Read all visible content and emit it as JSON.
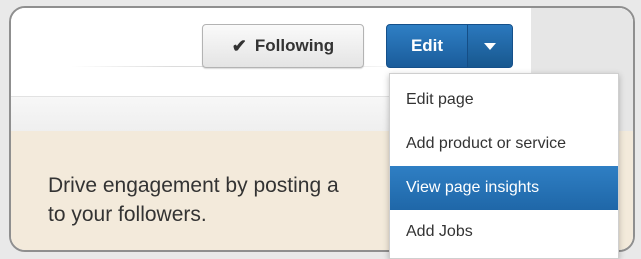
{
  "header": {
    "following_label": "Following",
    "following_icon": "checkmark-icon",
    "edit_label": "Edit",
    "edit_menu_icon": "caret-down-icon"
  },
  "dropdown": {
    "items": [
      {
        "label": "Edit page",
        "active": false
      },
      {
        "label": "Add product or service",
        "active": false
      },
      {
        "label": "View page insights",
        "active": true
      },
      {
        "label": "Add Jobs",
        "active": false
      }
    ]
  },
  "cta": {
    "line1": "Drive engagement by posting a",
    "line2": "to your followers."
  },
  "colors": {
    "accent": "#1f67a8",
    "cta_background": "#f3eadb"
  }
}
